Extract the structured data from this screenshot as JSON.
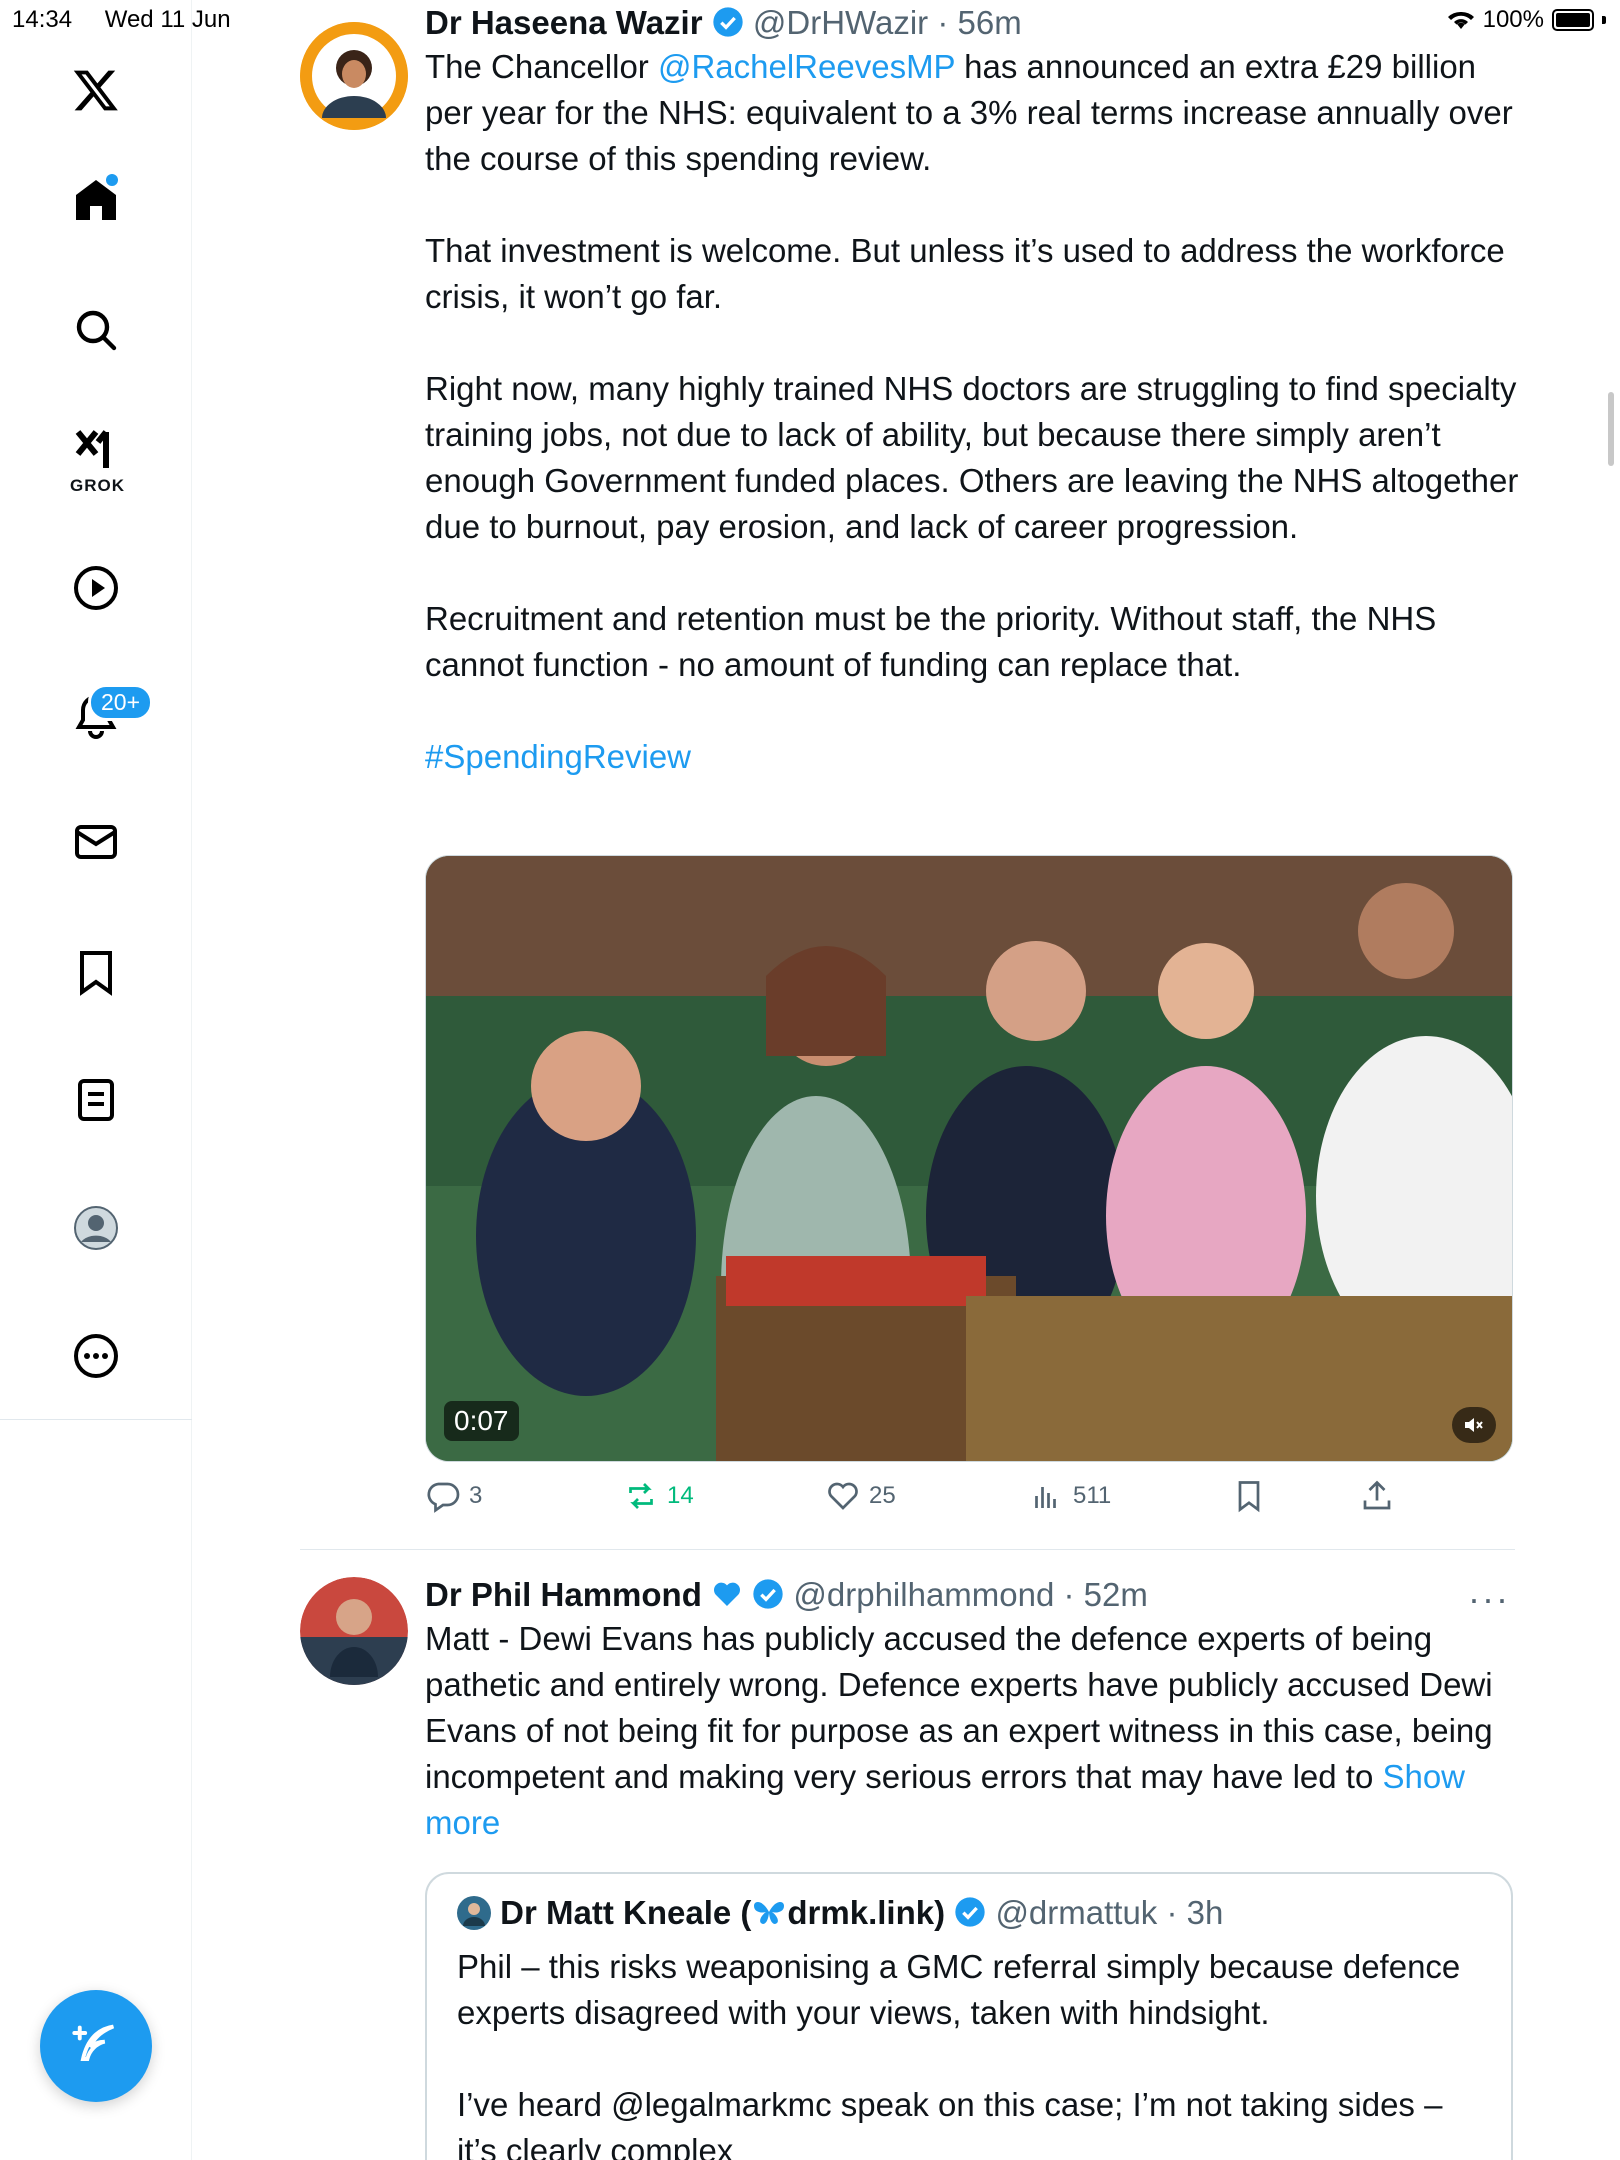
{
  "status_bar": {
    "time": "14:34",
    "date": "Wed 11 Jun",
    "battery": "100%"
  },
  "sidebar": {
    "notification_badge": "20+",
    "grok_label": "GROK"
  },
  "tweet1": {
    "name": "Dr Haseena Wazir",
    "handle": "@DrHWazir",
    "time": "56m",
    "mention": "@RachelReevesMP",
    "p1_before": "The Chancellor ",
    "p1_after": " has announced an extra £29 billion per year for the NHS: equivalent to a 3% real terms increase annually over the course of this spending review.",
    "p2": "That investment is welcome. But unless it’s used to address the workforce crisis, it won’t go far.",
    "p3": "Right now, many highly trained NHS doctors are struggling to find specialty training jobs, not due to lack of ability, but because there simply aren’t enough Government funded places. Others are leaving the NHS altogether due to burnout, pay erosion, and lack of career progression.",
    "p4": "Recruitment and retention must be the priority. Without staff, the NHS cannot function - no amount of funding can replace that.",
    "hashtag": "#SpendingReview",
    "video_time": "0:07",
    "replies": "3",
    "reposts": "14",
    "likes": "25",
    "views": "511"
  },
  "tweet2": {
    "name": "Dr Phil Hammond",
    "handle": "@drphilhammond",
    "time": "52m",
    "text": "Matt - Dewi Evans has publicly accused the defence experts of being pathetic and entirely wrong. Defence experts have publicly accused Dewi Evans of not being fit for purpose as an expert witness in this case, being incompetent and making very serious errors that may have led to ",
    "show_more": "Show more",
    "more": "···"
  },
  "quote": {
    "name": "Dr Matt Kneale (",
    "name_link": "drmk.link)",
    "handle": "@drmattuk",
    "time": "3h",
    "p1": "Phil – this risks weaponising a GMC referral simply because defence experts disagreed with your views, taken with hindsight.",
    "p2": "I’ve heard @legalmarkmc speak on this case; I’m not taking sides – it’s clearly complex"
  },
  "colors": {
    "accent": "#1d9bf0",
    "repost": "#00ba7c",
    "text": "#0f1419",
    "muted": "#536471"
  }
}
